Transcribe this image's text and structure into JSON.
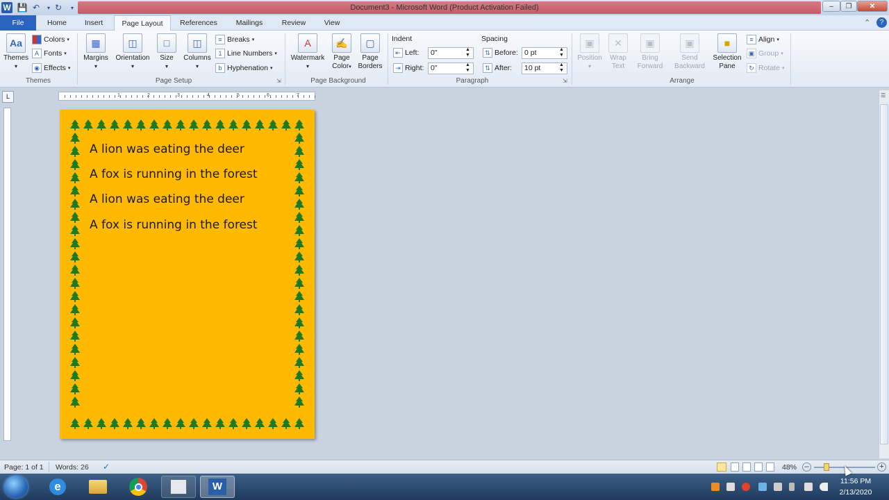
{
  "titlebar": {
    "title": "Document3  -  Microsoft Word (Product Activation Failed)",
    "app_icon": "W"
  },
  "tabs": [
    "File",
    "Home",
    "Insert",
    "Page Layout",
    "References",
    "Mailings",
    "Review",
    "View"
  ],
  "active_tab": "Page Layout",
  "ribbon": {
    "themes": {
      "label": "Themes",
      "group": "Themes",
      "colors": "Colors",
      "fonts": "Fonts",
      "effects": "Effects"
    },
    "page_setup": {
      "group": "Page Setup",
      "margins": "Margins",
      "orientation": "Orientation",
      "size": "Size",
      "columns": "Columns",
      "breaks": "Breaks",
      "line_numbers": "Line Numbers",
      "hyphenation": "Hyphenation"
    },
    "page_background": {
      "group": "Page Background",
      "watermark": "Watermark",
      "page_color_1": "Page",
      "page_color_2": "Color",
      "page_borders_1": "Page",
      "page_borders_2": "Borders"
    },
    "paragraph": {
      "group": "Paragraph",
      "indent": "Indent",
      "spacing": "Spacing",
      "left_label": "Left:",
      "right_label": "Right:",
      "left_value": "0\"",
      "right_value": "0\"",
      "before_label": "Before:",
      "after_label": "After:",
      "before_value": "0 pt",
      "after_value": "10 pt"
    },
    "arrange": {
      "group": "Arrange",
      "position": "Position",
      "wrap_1": "Wrap",
      "wrap_2": "Text",
      "bring_1": "Bring",
      "bring_2": "Forward",
      "send_1": "Send",
      "send_2": "Backward",
      "selection_1": "Selection",
      "selection_2": "Pane",
      "align": "Align",
      "group_btn": "Group",
      "rotate": "Rotate"
    }
  },
  "document": {
    "page_color": "#ffb900",
    "border_color": "#1f7a1f",
    "lines": [
      "A lion was eating the deer",
      "A fox is running in the forest",
      "A lion was eating the deer",
      "A fox is running in the forest"
    ]
  },
  "statusbar": {
    "page": "Page: 1 of 1",
    "words": "Words: 26",
    "zoom": "48%"
  },
  "taskbar": {
    "time": "11:56 PM",
    "date": "2/13/2020"
  },
  "ruler": {
    "h_numbers": [
      "1",
      "2",
      "3",
      "4",
      "5",
      "6",
      "7"
    ]
  }
}
